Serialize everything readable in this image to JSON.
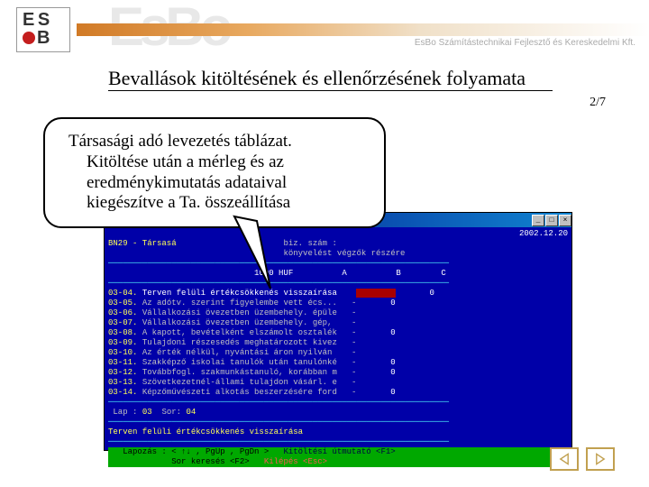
{
  "banner": {
    "logo_top": "E S",
    "logo_bottom": "B",
    "bg_letters": "EsBo",
    "subtitle": "EsBo Számítástechnikai Fejlesztő és Kereskedelmi Kft."
  },
  "title": "Bevallások kitöltésének és ellenőrzésének folyamata",
  "pager": "2/7",
  "callout": {
    "l1": "Társasági adó levezetés táblázat.",
    "l2": "Kitöltése után a mérleg és az",
    "l3": "eredménykimutatás adataival",
    "l4": "kiegészítve a Ta. összeállítása"
  },
  "dos": {
    "header_date": "2002.12.20",
    "header_line1": "BN29 - Társasá",
    "header_line2_a": "biz. szám :",
    "header_line2_b": "könyvelést végzők részére",
    "col_unit": "1000 HUF",
    "col_a": "A",
    "col_b": "B",
    "col_c": "C",
    "rows": [
      {
        "code": "03-04.",
        "txt": "Terven felüli értékcsökkenés visszaírása",
        "a": "",
        "b": "",
        "c": "0"
      },
      {
        "code": "03-05.",
        "txt": "Az adótv. szerint figyelembe vett écs...",
        "a": "-",
        "b": "0",
        "c": ""
      },
      {
        "code": "03-06.",
        "txt": "Vállalkozási övezetben üzembehely. épüle",
        "a": "-",
        "b": "",
        "c": ""
      },
      {
        "code": "03-07.",
        "txt": "Vállalkozási övezetben üzembehely. gép, ",
        "a": "-",
        "b": "",
        "c": ""
      },
      {
        "code": "03-08.",
        "txt": "A kapott, bevételként elszámolt osztalék",
        "a": "-",
        "b": "0",
        "c": ""
      },
      {
        "code": "03-09.",
        "txt": "Tulajdoni részesedés meghatározott kivez",
        "a": "-",
        "b": "",
        "c": ""
      },
      {
        "code": "03-10.",
        "txt": "Az érték nélkül, nyvántási áron nyilván",
        "a": "-",
        "b": "",
        "c": ""
      },
      {
        "code": "03-11.",
        "txt": "Szakképző iskolai tanulók után tanulónké",
        "a": "-",
        "b": "0",
        "c": ""
      },
      {
        "code": "03-12.",
        "txt": "Továbbfogl. szakmunkástanuló, korábban m",
        "a": "-",
        "b": "0",
        "c": ""
      },
      {
        "code": "03-13.",
        "txt": "Szövetkezetnél-állami tulajdon vásárl. e",
        "a": "-",
        "b": "",
        "c": ""
      },
      {
        "code": "03-14.",
        "txt": "Képzőművészeti alkotás beszerzésére ford",
        "a": "-",
        "b": "0",
        "c": ""
      }
    ],
    "lap_label": "Lap :",
    "lap_val": "03",
    "sor_label": "Sor:",
    "sor_val": "04",
    "status": "Terven felüli értékcsökkenés visszaírása",
    "footer1a": "Lapozás : < ↑↓ , PgUp , PgDn >",
    "footer1b": "Kitöltési útmutató <F1>",
    "footer2a": "Sor keresés <F2>",
    "footer2b": "Kilépés <Esc>"
  }
}
